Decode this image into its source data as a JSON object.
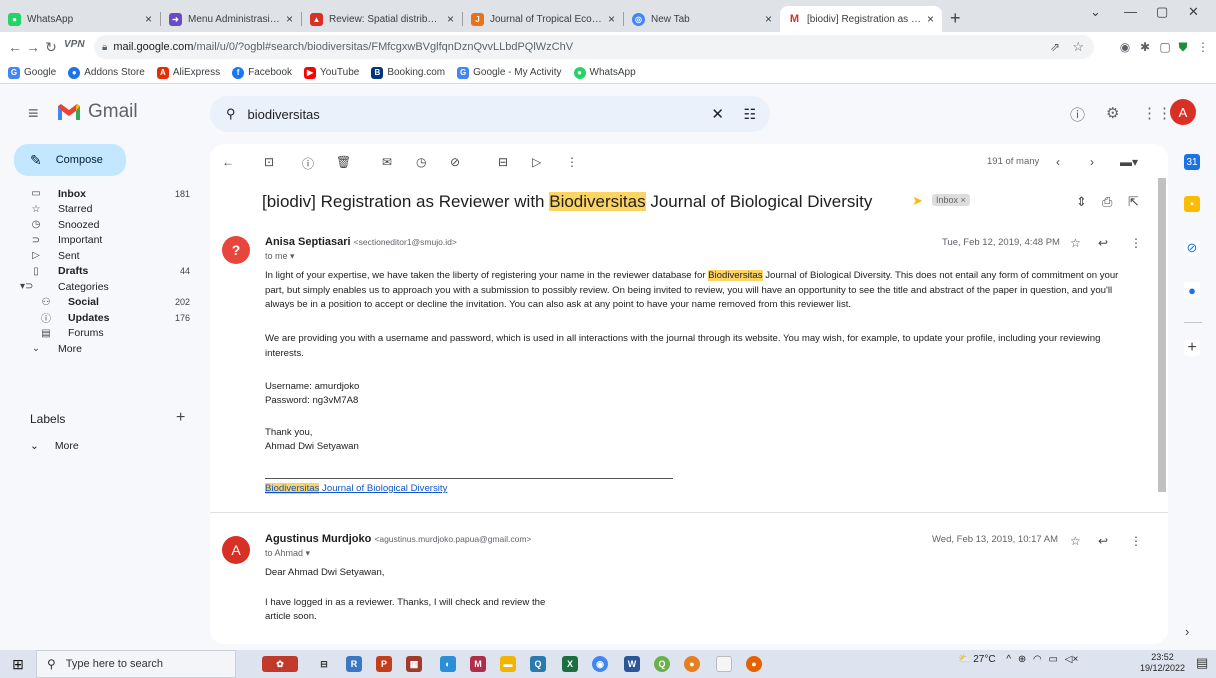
{
  "browser": {
    "tabs": [
      {
        "title": "WhatsApp",
        "color": "#25d366",
        "active": false
      },
      {
        "title": "Menu Administrasi Sistem I",
        "color": "#6a4bc4",
        "active": false
      },
      {
        "title": "Review: Spatial distribution",
        "color": "#d93025",
        "active": false
      },
      {
        "title": "Journal of Tropical Ecology",
        "color": "#e8711a",
        "active": false
      },
      {
        "title": "New Tab",
        "color": "#4285f4",
        "active": false
      },
      {
        "title": "[biodiv] Registration as Rev",
        "color": "#d93025",
        "active": true
      }
    ],
    "url_host": "mail.google.com",
    "url_path": "/mail/u/0/?ogbl#search/biodiversitas/FMfcgxwBVglfqnDznQvvLLbdPQlWzChV",
    "vpn_label": "VPN",
    "bookmarks": [
      {
        "label": "Google",
        "color": "#4285f4",
        "glyph": "G"
      },
      {
        "label": "Addons Store",
        "color": "#1a73e8",
        "glyph": "●"
      },
      {
        "label": "AliExpress",
        "color": "#e62e04",
        "glyph": "A"
      },
      {
        "label": "Facebook",
        "color": "#1877f2",
        "glyph": "f"
      },
      {
        "label": "YouTube",
        "color": "#ff0000",
        "glyph": "▶"
      },
      {
        "label": "Booking.com",
        "color": "#003580",
        "glyph": "B"
      },
      {
        "label": "Google - My Activity",
        "color": "#4285f4",
        "glyph": "G"
      },
      {
        "label": "WhatsApp",
        "color": "#25d366",
        "glyph": "●"
      }
    ]
  },
  "gmail": {
    "app_name": "Gmail",
    "search_value": "biodiversitas",
    "avatar_letter": "A",
    "compose_label": "Compose",
    "nav": [
      {
        "label": "Inbox",
        "count": "181",
        "icon": "inbox-icon",
        "glyph": "▭",
        "bold": true
      },
      {
        "label": "Starred",
        "count": "",
        "icon": "star-icon",
        "glyph": "☆",
        "bold": false
      },
      {
        "label": "Snoozed",
        "count": "",
        "icon": "clock-icon",
        "glyph": "◷",
        "bold": false
      },
      {
        "label": "Important",
        "count": "",
        "icon": "important-icon",
        "glyph": "⊃",
        "bold": false
      },
      {
        "label": "Sent",
        "count": "",
        "icon": "send-icon",
        "glyph": "▷",
        "bold": false
      },
      {
        "label": "Drafts",
        "count": "44",
        "icon": "draft-icon",
        "glyph": "▯",
        "bold": true
      },
      {
        "label": "Categories",
        "count": "",
        "icon": "label-icon",
        "glyph": "▾⊃",
        "bold": false
      },
      {
        "label": "Social",
        "count": "202",
        "icon": "people-icon",
        "glyph": "⚇",
        "bold": true,
        "sub": true
      },
      {
        "label": "Updates",
        "count": "176",
        "icon": "info-icon",
        "glyph": "ⓘ",
        "bold": true,
        "sub": true
      },
      {
        "label": "Forums",
        "count": "",
        "icon": "forum-icon",
        "glyph": "▤",
        "bold": false,
        "sub": true
      },
      {
        "label": "More",
        "count": "",
        "icon": "chevron-down-icon",
        "glyph": "⌄",
        "bold": false
      }
    ],
    "labels_title": "Labels",
    "labels_more": "More",
    "pager": "191 of many",
    "subject_pre": "[biodiv] Registration as Reviewer with ",
    "subject_hl": "Biodiversitas",
    "subject_post": " Journal of Biological Diversity",
    "label_chip": "Inbox ×",
    "messages": [
      {
        "sender": "Anisa Septiasari",
        "email": "<sectioneditor1@smujo.id>",
        "to": "to me ▾",
        "date": "Tue, Feb 12, 2019, 4:48 PM",
        "avatar": "?",
        "avatar_color": "#e8453c",
        "p1_pre": "In light of your expertise, we have taken the liberty of registering your name in the reviewer database for ",
        "p1_hl": "Biodiversitas",
        "p1_post": " Journal of Biological Diversity. This does not entail any form of commitment on your part, but simply enables us to approach you with a submission to possibly review. On being invited to review, you will have an opportunity to see the title and abstract of the paper in question, and you'll always be in a position to accept or decline the invitation. You can also ask at any point to have your name removed from this reviewer list.",
        "p2": "We are providing you with a username and password, which is used in all interactions with the journal through its website. You may wish, for example, to update your profile, including your reviewing interests.",
        "username": "Username: amurdjoko",
        "password": "Password: ng3vM7A8",
        "thanks": "Thank you,",
        "signer": "Ahmad Dwi Setyawan",
        "sig_hl": "Biodiversitas",
        "sig_rest": " Journal of Biological Diversity"
      },
      {
        "sender": "Agustinus Murdjoko",
        "email": "<agustinus.murdjoko.papua@gmail.com>",
        "to": "to Ahmad ▾",
        "date": "Wed, Feb 13, 2019, 10:17 AM",
        "avatar": "A",
        "avatar_color": "#d93025",
        "greeting": "Dear Ahmad Dwi Setyawan,",
        "line1": "I have logged in as a reviewer.  Thanks, I will check and review the",
        "line2": "article soon."
      }
    ]
  },
  "taskbar": {
    "search_placeholder": "Type here to search",
    "weather": "27°C",
    "time": "23:52",
    "date": "19/12/2022"
  }
}
